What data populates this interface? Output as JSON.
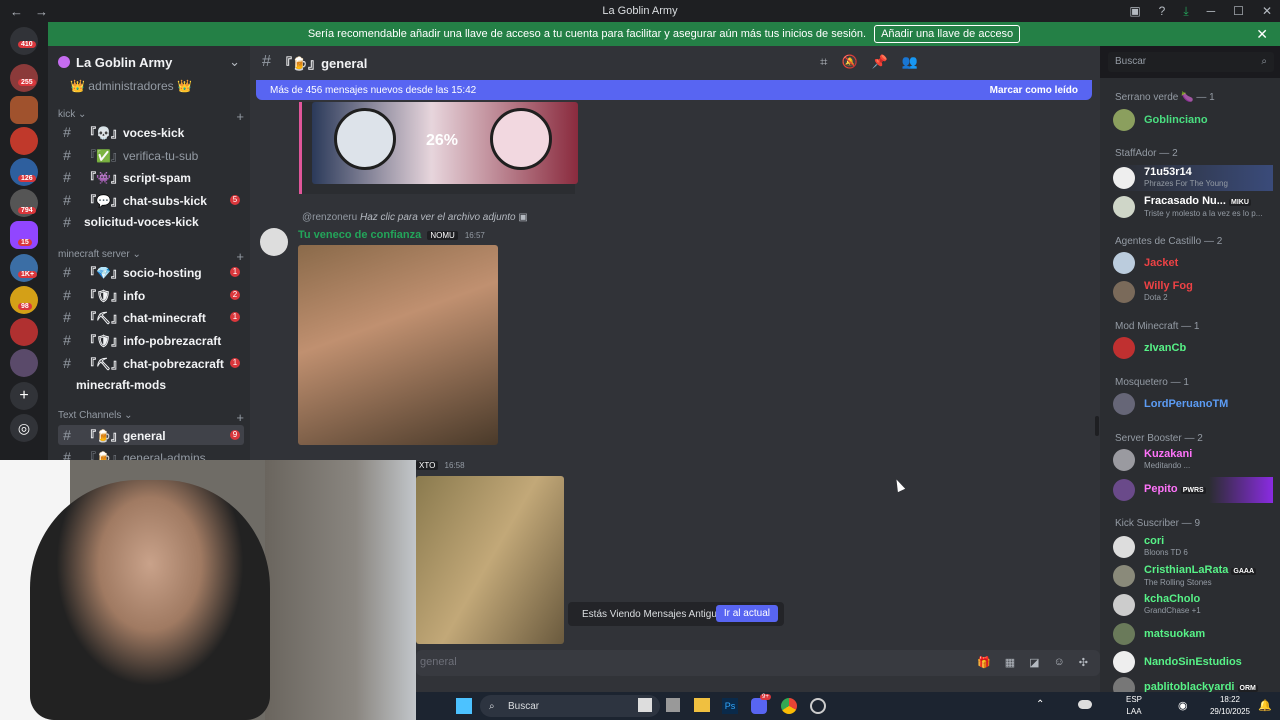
{
  "window": {
    "title": "La Goblin Army",
    "nav": [
      "←",
      "→"
    ],
    "controls": [
      "▣",
      "?",
      "⤓",
      "─",
      "☐",
      "✕"
    ]
  },
  "banner": {
    "text": "Sería recomendable añadir una llave de acceso a tu cuenta para facilitar y asegurar aún más tus inicios de sesión.",
    "button": "Añadir una llave de acceso",
    "close": "✕"
  },
  "guild_badges": [
    "410",
    "255",
    "126",
    "794",
    "15",
    "1K+",
    "98"
  ],
  "server": {
    "name": "La Goblin Army",
    "chevron": "⌄",
    "top_item": "👑 administradores 👑",
    "categories": [
      {
        "label": "kick ⌄",
        "plus": "+"
      },
      {
        "label": "minecraft server ⌄",
        "plus": "+"
      },
      {
        "label": "Text Channels ⌄",
        "plus": "+"
      }
    ],
    "channels": [
      {
        "name": "『💀』voces-kick",
        "badge": ""
      },
      {
        "name": "『✅』verifica-tu-sub",
        "badge": ""
      },
      {
        "name": "『👾』script-spam",
        "badge": ""
      },
      {
        "name": "『💬』chat-subs-kick",
        "badge": "5"
      },
      {
        "name": "solicitud-voces-kick",
        "badge": ""
      },
      {
        "name": "『💎』socio-hosting",
        "badge": "1"
      },
      {
        "name": "『🛡』info",
        "badge": "2"
      },
      {
        "name": "『⛏』chat-minecraft",
        "badge": "1"
      },
      {
        "name": "『🛡』info-pobrezacraft",
        "badge": ""
      },
      {
        "name": "『⛏』chat-pobrezacraft",
        "badge": "1"
      },
      {
        "name": "minecraft-mods",
        "badge": ""
      },
      {
        "name": "『🍺』general",
        "badge": "9"
      },
      {
        "name": "『🍺』general-admins",
        "badge": ""
      }
    ]
  },
  "chat": {
    "channel": "『🍺』general",
    "new_messages": "Más de 456 mensajes nuevos desde las 15:42",
    "mark_read": "Marcar como leído",
    "pct": "26%",
    "reply_user": "@renzoneru",
    "reply_text": "Haz clic para ver el archivo adjunto",
    "author": "Tu veneco de confianza",
    "author_tag": "NOMU",
    "time1": "16:57",
    "tag2": "XTO",
    "time2": "16:58",
    "toast_text": "Estás Viendo Mensajes Antiguos",
    "toast_button": "Ir al actual",
    "composer_placeholder": "general"
  },
  "search": {
    "placeholder": "Buscar",
    "icon": "⌕"
  },
  "members": {
    "groups": [
      "Serrano verde 🍆 — 1",
      "StaffAdor — 2",
      "Agentes de Castillo — 2",
      "Mod Minecraft — 1",
      "Mosquetero — 1",
      "Server Booster — 2",
      "Kick Suscriber — 9"
    ],
    "list": [
      {
        "name": "Goblinciano",
        "activity": "",
        "color": "#4ade80"
      },
      {
        "name": "71u53r14",
        "activity": "Phrazes For The Young",
        "color": "#ffffff"
      },
      {
        "name": "Fracasado Nu...",
        "activity": "Triste y molesto a la vez es lo p...",
        "color": "#ffffff",
        "tag": "MIKU"
      },
      {
        "name": "Jacket",
        "activity": "",
        "color": "#ed4245"
      },
      {
        "name": "Willy Fog",
        "activity": "Dota 2",
        "color": "#ed4245"
      },
      {
        "name": "zIvanCb",
        "activity": "",
        "color": "#57f287"
      },
      {
        "name": "LordPeruanoTM",
        "activity": "",
        "color": "#5c9cf5"
      },
      {
        "name": "Kuzakani",
        "activity": "Meditando ...",
        "color": "#ff73fa"
      },
      {
        "name": "Pepito",
        "activity": "",
        "color": "#ff73fa",
        "tag": "PWRS"
      },
      {
        "name": "cori",
        "activity": "Bloons TD 6",
        "color": "#57f287"
      },
      {
        "name": "CristhianLaRata",
        "activity": "The Rolling Stones",
        "color": "#57f287",
        "tag": "GAAA"
      },
      {
        "name": "kchaCholo",
        "activity": "GrandChase +1",
        "color": "#57f287"
      },
      {
        "name": "matsuokam",
        "activity": "",
        "color": "#57f287"
      },
      {
        "name": "NandoSinEstudios",
        "activity": "",
        "color": "#57f287"
      },
      {
        "name": "pablitoblackyardi",
        "activity": "",
        "color": "#57f287",
        "tag": "ORM"
      }
    ]
  },
  "taskbar": {
    "search": "Buscar",
    "lang1": "ESP",
    "lang2": "LAA",
    "time": "18:22",
    "date": "29/10/2025",
    "app_badge": "9+"
  }
}
